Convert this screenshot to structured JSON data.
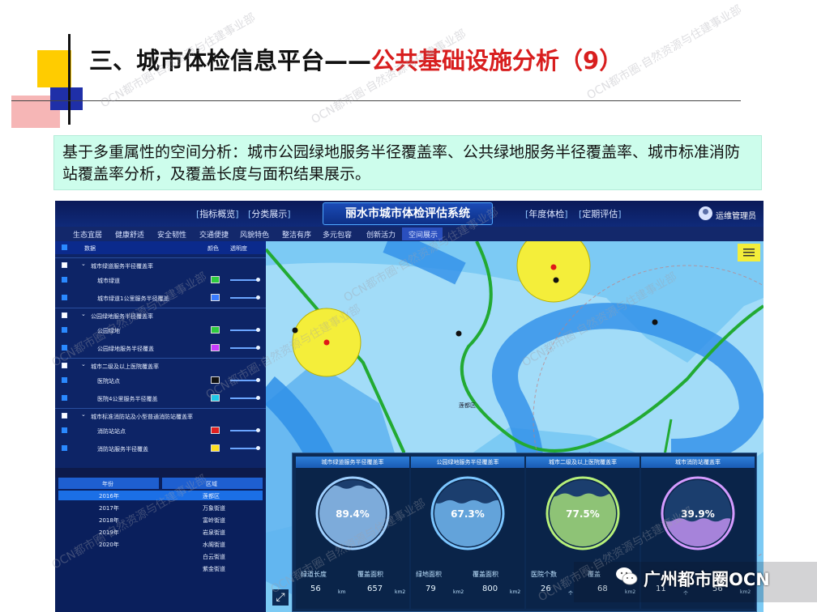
{
  "slide": {
    "title_prefix": "三、城市体检信息平台——",
    "title_highlight": "公共基础设施分析（",
    "title_num": "9",
    "title_suffix": "）",
    "description": "基于多重属性的空间分析：城市公园绿地服务半径覆盖率、公共绿地服务半径覆盖率、城市标准消防站覆盖率分析，及覆盖长度与面积结果展示。"
  },
  "app": {
    "system_title": "丽水市城市体检评估系统",
    "top_left_buttons": [
      "指标概览",
      "分类展示"
    ],
    "top_right_buttons": [
      "年度体检",
      "定期评估"
    ],
    "user": "运维管理员",
    "nav": [
      "生态宜居",
      "健康舒适",
      "安全韧性",
      "交通便捷",
      "风貌特色",
      "整洁有序",
      "多元包容",
      "创新活力",
      "空间展示"
    ],
    "layer_header": {
      "name": "数据",
      "col1": "颜色",
      "col2": "透明度"
    },
    "layers": [
      {
        "label": "城市绿道服务半径覆盖率",
        "group": true,
        "checked": false
      },
      {
        "label": "城市绿道",
        "group": false,
        "checked": true,
        "color": "#2ecc40"
      },
      {
        "label": "城市绿道1公里服务半径覆盖",
        "group": false,
        "checked": true,
        "color": "#3a7cff"
      },
      {
        "label": "公园绿地服务半径覆盖率",
        "group": true,
        "checked": false
      },
      {
        "label": "公园绿地",
        "group": false,
        "checked": true,
        "color": "#2ecc40"
      },
      {
        "label": "公园绿地服务半径覆盖",
        "group": false,
        "checked": true,
        "color": "#c83cff"
      },
      {
        "label": "城市二级及以上医院覆盖率",
        "group": true,
        "checked": false
      },
      {
        "label": "医院站点",
        "group": false,
        "checked": true,
        "color": "#111111"
      },
      {
        "label": "医院4公里服务半径覆盖",
        "group": false,
        "checked": true,
        "color": "#1ec8e8"
      },
      {
        "label": "城市标准消防站及小型普通消防站覆盖率",
        "group": true,
        "checked": false
      },
      {
        "label": "消防站站点",
        "group": false,
        "checked": true,
        "color": "#e02020"
      },
      {
        "label": "消防站服务半径覆盖",
        "group": false,
        "checked": true,
        "color": "#ffe020"
      }
    ],
    "year_table": {
      "headers": [
        "年份",
        "区域"
      ],
      "years": [
        "2016年",
        "2017年",
        "2018年",
        "2019年",
        "2020年"
      ],
      "regions": [
        "莲都区",
        "万象街道",
        "富岭街道",
        "岩泉街道",
        "水阁街道",
        "白云街道",
        "紫金街道"
      ]
    },
    "map_label": "莲都区",
    "stats": [
      {
        "title": "城市绿道服务半径覆盖率",
        "percent": "89.4%",
        "fill": 0.894,
        "color": "#9fd0ff",
        "m1_label": "绿道长度",
        "m1_value": "56",
        "m1_unit": "km",
        "m2_label": "覆盖面积",
        "m2_value": "657",
        "m2_unit": "km2"
      },
      {
        "title": "公园绿地服务半径覆盖率",
        "percent": "67.3%",
        "fill": 0.673,
        "color": "#7cc6ff",
        "m1_label": "绿地面积",
        "m1_value": "79",
        "m1_unit": "km2",
        "m2_label": "覆盖面积",
        "m2_value": "800",
        "m2_unit": "km2"
      },
      {
        "title": "城市二级及以上医院覆盖率",
        "percent": "77.5%",
        "fill": 0.775,
        "color": "#b6f07a",
        "m1_label": "医院个数",
        "m1_value": "26",
        "m1_unit": "个",
        "m2_label": "覆盖",
        "m2_value": "68",
        "m2_unit": "km2"
      },
      {
        "title": "城市消防站覆盖率",
        "percent": "39.9%",
        "fill": 0.399,
        "color": "#d59bff",
        "m1_label": "",
        "m1_value": "11",
        "m1_unit": "个",
        "m2_label": "",
        "m2_value": "56",
        "m2_unit": "km2"
      }
    ]
  },
  "overlay": {
    "brand": "广州都市圈OCN",
    "watermark": "OCN都市圈·自然资源与住建事业部"
  },
  "colors": {
    "title_red": "#d81e1e",
    "desc_bg": "#cdfdec",
    "coverage_blue": "#3aa0ff",
    "greenway": "#22aa33",
    "fire_yellow": "#f4ee3a"
  }
}
